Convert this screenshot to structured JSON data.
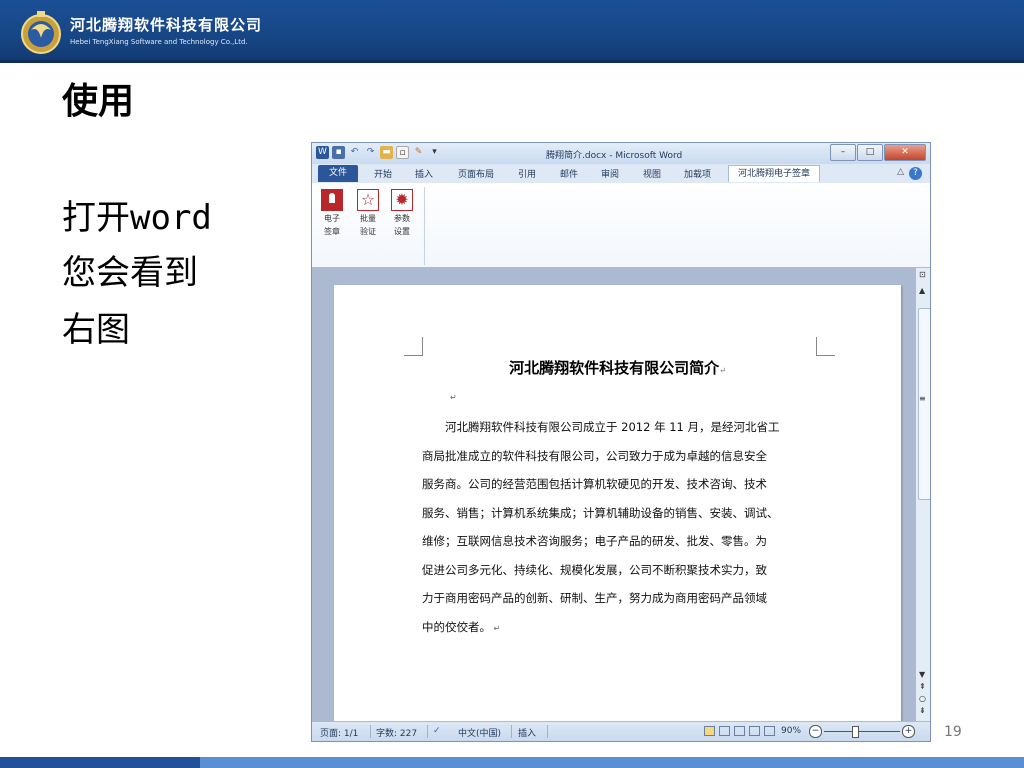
{
  "header": {
    "company_cn": "河北腾翔软件科技有限公司",
    "company_en": "Hebei TengXiang Software and Technology Co.,Ltd."
  },
  "slide": {
    "title": "使用",
    "bullet_1": "打开word",
    "bullet_2": "您会看到",
    "bullet_3": "右图",
    "page_number": "19"
  },
  "word": {
    "window_title": "腾翔简介.docx - Microsoft Word",
    "tabs": [
      "开始",
      "插入",
      "页面布局",
      "引用",
      "邮件",
      "审阅",
      "视图",
      "加载项"
    ],
    "file_tab": "文件",
    "active_tab": "河北腾翔电子签章",
    "ribbon_buttons": [
      {
        "line1": "电子",
        "line2": "签章",
        "icon": "seal-icon"
      },
      {
        "line1": "批量",
        "line2": "验证",
        "icon": "star-verify-icon"
      },
      {
        "line1": "参数",
        "line2": "设置",
        "icon": "gear-settings-icon"
      }
    ],
    "document": {
      "heading": "河北腾翔软件科技有限公司简介",
      "lines": [
        "河北腾翔软件科技有限公司成立于 2012 年 11 月，是经河北省工",
        "商局批准成立的软件科技有限公司，公司致力于成为卓越的信息安全",
        "服务商。公司的经营范围包括计算机软硬见的开发、技术咨询、技术",
        "服务、销售；计算机系统集成；计算机辅助设备的销售、安装、调试、",
        "维修；互联网信息技术咨询服务；电子产品的研发、批发、零售。为",
        "促进公司多元化、持续化、规模化发展，公司不断积聚技术实力，致",
        "力于商用密码产品的创新、研制、生产，努力成为商用密码产品领域",
        "中的佼佼者。"
      ]
    },
    "status": {
      "page": "页面: 1/1",
      "words": "字数: 227",
      "language": "中文(中国)",
      "mode": "插入",
      "zoom": "90%"
    }
  },
  "colors": {
    "header_blue": "#1b4f95",
    "word_file_tab": "#2b579a",
    "seal_red": "#b8282b"
  }
}
